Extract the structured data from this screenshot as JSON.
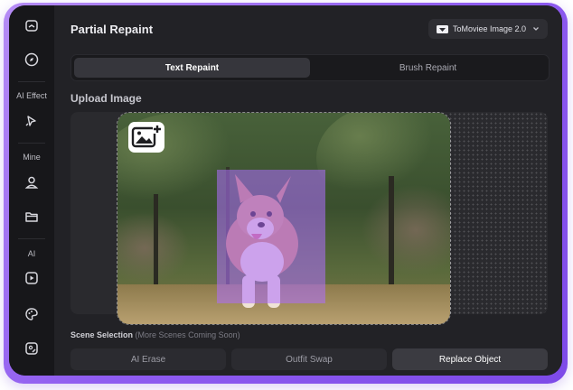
{
  "sidebar": {
    "items": [
      {
        "icon": "home-icon"
      },
      {
        "icon": "compass-icon"
      }
    ],
    "sections": [
      {
        "label": "AI Effect",
        "icons": [
          "ai-cursor-icon"
        ]
      },
      {
        "label": "Mine",
        "icons": [
          "user-icon",
          "folder-icon"
        ]
      },
      {
        "label": "AI",
        "icons": [
          "video-play-icon",
          "palette-icon",
          "image-edit-icon"
        ]
      }
    ]
  },
  "header": {
    "title": "Partial Repaint",
    "model": "ToMoviee Image 2.0"
  },
  "tabs": [
    {
      "label": "Text Repaint",
      "active": true
    },
    {
      "label": "Brush Repaint",
      "active": false
    }
  ],
  "upload": {
    "title": "Upload Image",
    "add_icon": "add-image-icon"
  },
  "scene": {
    "title": "Scene Selection",
    "subtitle": "(More Scenes Coming Soon)",
    "options": [
      "AI Erase",
      "Outfit Swap",
      "Replace Object"
    ],
    "selected": "Replace Object"
  },
  "colors": {
    "accent": "#8f5cf0",
    "mask": "#af6eff"
  }
}
